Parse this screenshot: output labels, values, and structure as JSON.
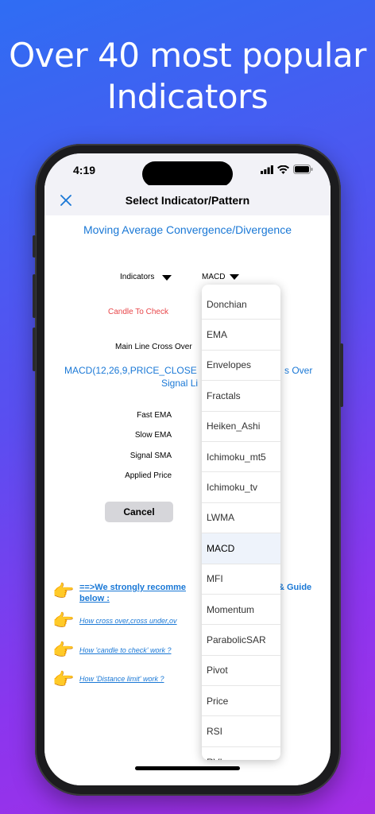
{
  "headline": {
    "line1": "Over 40 most popular",
    "line2": "Indicators"
  },
  "status_bar": {
    "time": "4:19"
  },
  "nav": {
    "title": "Select Indicator/Pattern"
  },
  "main": {
    "title": "Moving Average Convergence/Divergence",
    "indicators_label": "Indicators",
    "indicator_value": "MACD",
    "candle_label": "Candle To Check",
    "condition_label": "Main Line Cross Over",
    "description_line1": "MACD(12,26,9,PRICE_CLOSE",
    "description_line1_tail": "s Over",
    "description_line2": "Signal Li",
    "fields": [
      "Fast EMA",
      "Slow EMA",
      "Signal SMA",
      "Applied Price"
    ],
    "cancel_label": "Cancel"
  },
  "guides": {
    "hand": "👉",
    "strong_line1": "==>We strongly recomme",
    "strong_line1_tail": "& Guide",
    "strong_line2": "below :",
    "link1": "How cross over,cross under,ov",
    "link2": "How 'candle to check' work ?",
    "link3": "How 'Distance limit' work ?"
  },
  "dropdown": {
    "items": [
      "Donchian",
      "EMA",
      "Envelopes",
      "Fractals",
      "Heiken_Ashi",
      "Ichimoku_mt5",
      "Ichimoku_tv",
      "LWMA",
      "MACD",
      "MFI",
      "Momentum",
      "ParabolicSAR",
      "Pivot",
      "Price",
      "RSI",
      "RVI"
    ],
    "selected": "MACD"
  },
  "colors": {
    "accent_blue": "#1a78d6",
    "warning_red": "#e8474a"
  }
}
